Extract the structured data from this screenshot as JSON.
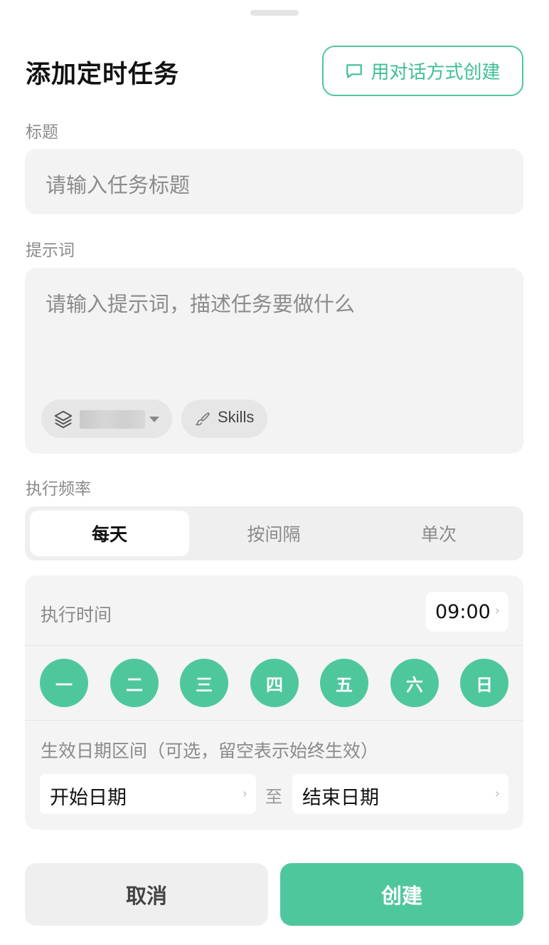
{
  "header": {
    "title": "添加定时任务",
    "chat_create_label": "用对话方式创建"
  },
  "title_field": {
    "label": "标题",
    "placeholder": "请输入任务标题"
  },
  "prompt_field": {
    "label": "提示词",
    "placeholder": "请输入提示词，描述任务要做什么",
    "skills_label": "Skills"
  },
  "frequency": {
    "label": "执行频率",
    "tabs": [
      "每天",
      "按间隔",
      "单次"
    ],
    "selected": "每天"
  },
  "schedule": {
    "time_label": "执行时间",
    "time_value": "09:00",
    "days": [
      "一",
      "二",
      "三",
      "四",
      "五",
      "六",
      "日"
    ],
    "range_label": "生效日期区间（可选，留空表示始终生效）",
    "start_placeholder": "开始日期",
    "to_label": "至",
    "end_placeholder": "结束日期"
  },
  "actions": {
    "cancel_label": "取消",
    "create_label": "创建"
  },
  "colors": {
    "accent": "#4fc79d",
    "surface": "#f3f3f3"
  }
}
